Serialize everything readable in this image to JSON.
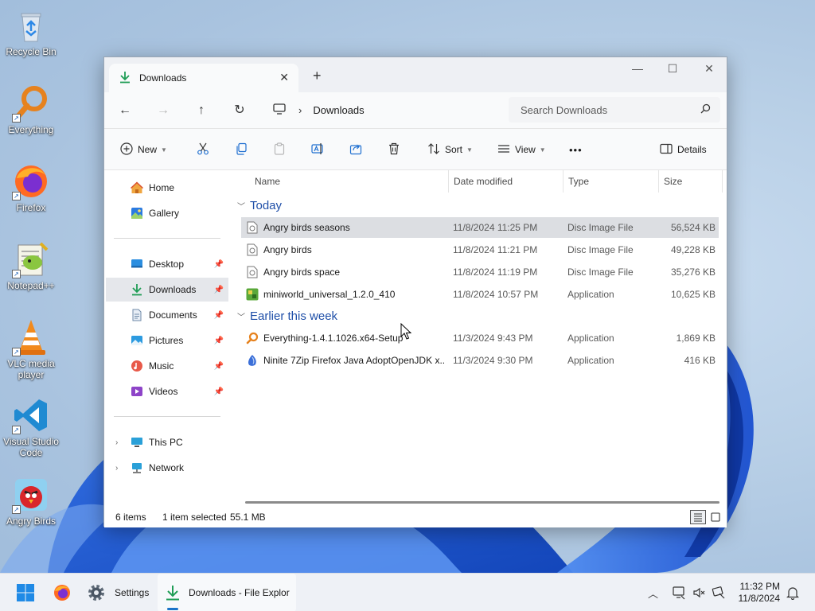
{
  "desktop": {
    "icons": [
      {
        "label": "Recycle Bin",
        "icon": "recycle-bin-icon"
      },
      {
        "label": "Everything",
        "icon": "everything-icon"
      },
      {
        "label": "Firefox",
        "icon": "firefox-icon"
      },
      {
        "label": "Notepad++",
        "icon": "notepadpp-icon"
      },
      {
        "label": "VLC media player",
        "icon": "vlc-icon"
      },
      {
        "label": "Visual Studio Code",
        "icon": "vscode-icon"
      },
      {
        "label": "Angry Birds",
        "icon": "angry-birds-icon"
      }
    ]
  },
  "window": {
    "tab_title": "Downloads",
    "tab_close": "✕",
    "new_tab": "+",
    "minimize": "—",
    "maximize": "☐",
    "close": "✕"
  },
  "nav": {
    "back": "←",
    "forward": "→",
    "up": "↑",
    "refresh": "↻",
    "breadcrumb_sep": "›",
    "breadcrumb": "Downloads",
    "search_placeholder": "Search Downloads"
  },
  "toolbar": {
    "new_label": "New",
    "sort_label": "Sort",
    "view_label": "View",
    "more_label": "•••",
    "details_label": "Details"
  },
  "sidebar": {
    "items": [
      {
        "label": "Home",
        "icon": "home-icon"
      },
      {
        "label": "Gallery",
        "icon": "gallery-icon"
      },
      {
        "label": "Desktop",
        "icon": "desktop-folder-icon"
      },
      {
        "label": "Downloads",
        "icon": "downloads-icon"
      },
      {
        "label": "Documents",
        "icon": "documents-icon"
      },
      {
        "label": "Pictures",
        "icon": "pictures-icon"
      },
      {
        "label": "Music",
        "icon": "music-icon"
      },
      {
        "label": "Videos",
        "icon": "videos-icon"
      },
      {
        "label": "This PC",
        "icon": "this-pc-icon"
      },
      {
        "label": "Network",
        "icon": "network-icon"
      }
    ],
    "pin_glyph": "📌",
    "expand_glyph": "›"
  },
  "columns": {
    "name": "Name",
    "date": "Date modified",
    "type": "Type",
    "size": "Size"
  },
  "groups": [
    {
      "label": "Today",
      "files": [
        {
          "name": "Angry birds seasons",
          "date": "11/8/2024 11:25 PM",
          "type": "Disc Image File",
          "size": "56,524 KB",
          "icon": "disc-image-icon",
          "selected": true
        },
        {
          "name": "Angry birds",
          "date": "11/8/2024 11:21 PM",
          "type": "Disc Image File",
          "size": "49,228 KB",
          "icon": "disc-image-icon"
        },
        {
          "name": "Angry birds space",
          "date": "11/8/2024 11:19 PM",
          "type": "Disc Image File",
          "size": "35,276 KB",
          "icon": "disc-image-icon"
        },
        {
          "name": "miniworld_universal_1.2.0_410",
          "date": "11/8/2024 10:57 PM",
          "type": "Application",
          "size": "10,625 KB",
          "icon": "miniworld-app-icon"
        }
      ]
    },
    {
      "label": "Earlier this week",
      "files": [
        {
          "name": "Everything-1.4.1.1026.x64-Setup",
          "date": "11/3/2024 9:43 PM",
          "type": "Application",
          "size": "1,869 KB",
          "icon": "everything-app-icon"
        },
        {
          "name": "Ninite 7Zip Firefox Java AdoptOpenJDK x...",
          "date": "11/3/2024 9:30 PM",
          "type": "Application",
          "size": "416 KB",
          "icon": "ninite-app-icon"
        }
      ]
    }
  ],
  "status": {
    "item_count": "6 items",
    "selection": "1 item selected",
    "selection_size": "55.1 MB"
  },
  "taskbar": {
    "settings_label": "Settings",
    "explorer_label": "Downloads - File Explor",
    "time": "11:32 PM",
    "date": "11/8/2024",
    "tray_chevron": "︿"
  },
  "colors": {
    "accent": "#1a73c8",
    "group_header": "#1f4fa8",
    "selection": "#dcdee2"
  }
}
